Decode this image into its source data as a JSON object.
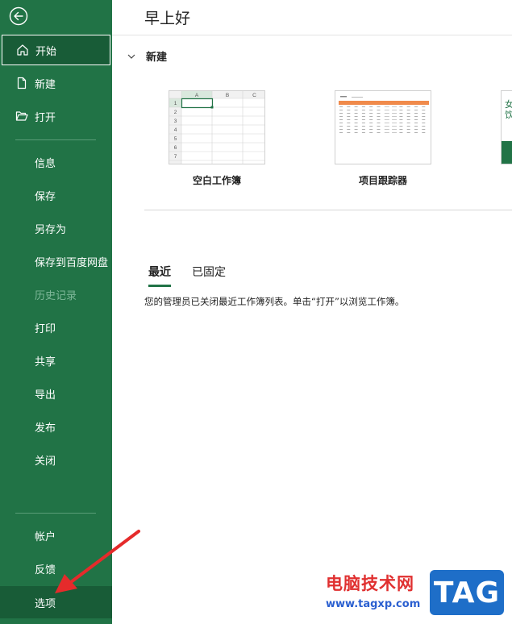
{
  "sidebar": {
    "items": [
      {
        "label": "开始",
        "icon": "home-icon",
        "state": "active"
      },
      {
        "label": "新建",
        "icon": "new-document-icon"
      },
      {
        "label": "打开",
        "icon": "open-folder-icon"
      },
      {
        "label": "信息"
      },
      {
        "label": "保存"
      },
      {
        "label": "另存为"
      },
      {
        "label": "保存到百度网盘"
      },
      {
        "label": "历史记录",
        "state": "disabled"
      },
      {
        "label": "打印"
      },
      {
        "label": "共享"
      },
      {
        "label": "导出"
      },
      {
        "label": "发布"
      },
      {
        "label": "关闭"
      },
      {
        "label": "帐户"
      },
      {
        "label": "反馈"
      },
      {
        "label": "选项",
        "state": "selected"
      }
    ]
  },
  "main": {
    "greeting": "早上好",
    "new_section": {
      "title": "新建",
      "templates": [
        {
          "caption": "空白工作簿"
        },
        {
          "caption": "项目跟踪器"
        }
      ],
      "partial_template_text": "女\n饮"
    },
    "tabs": [
      {
        "label": "最近",
        "active": true
      },
      {
        "label": "已固定",
        "active": false
      }
    ],
    "notice": "您的管理员已关闭最近工作簿列表。单击“打开”以浏览工作簿。",
    "blank_sheet": {
      "columns": [
        "A",
        "B",
        "C"
      ],
      "rows": [
        "1",
        "2",
        "3",
        "4",
        "5",
        "6",
        "7"
      ]
    }
  },
  "watermark": {
    "title": "电脑技术网",
    "url": "www.tagxp.com",
    "logo": "TAG"
  },
  "colors": {
    "sidebar_bg": "#217346",
    "sidebar_active": "#185c37",
    "accent": "#217346",
    "arrow": "#e52b2b"
  }
}
